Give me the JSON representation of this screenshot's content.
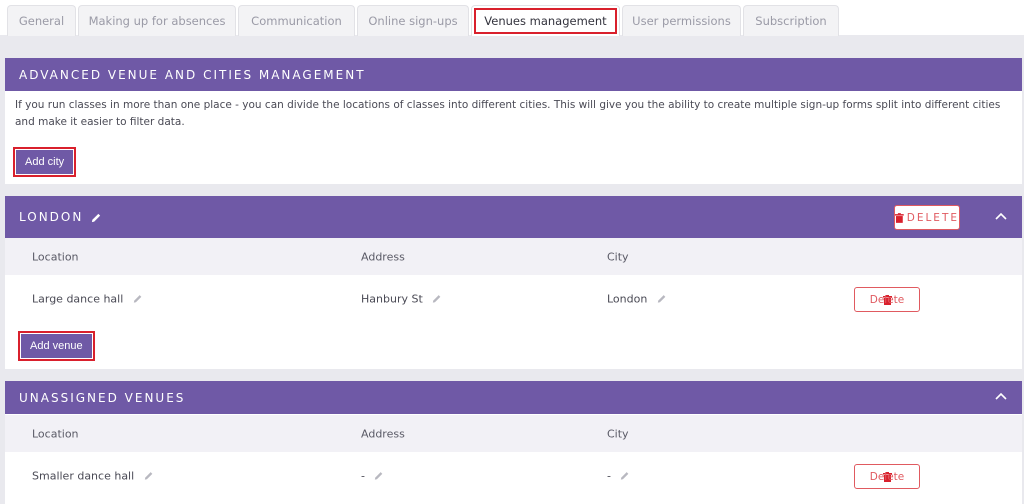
{
  "tabs": [
    {
      "label": "General",
      "active": false
    },
    {
      "label": "Making up for absences",
      "active": false
    },
    {
      "label": "Communication",
      "active": false
    },
    {
      "label": "Online sign-ups",
      "active": false
    },
    {
      "label": "Venues management",
      "active": true
    },
    {
      "label": "User permissions",
      "active": false
    },
    {
      "label": "Subscription",
      "active": false
    }
  ],
  "advanced": {
    "title": "ADVANCED VENUE AND CITIES MANAGEMENT",
    "description": "If you run classes in more than one place - you can divide the locations of classes into different cities. This will give you the ability to create multiple sign-up forms split into different cities and make it easier to filter data.",
    "add_city_label": "Add city"
  },
  "london": {
    "title": "LONDON",
    "delete_label": "Delete",
    "columns": [
      "Location",
      "Address",
      "City"
    ],
    "rows": [
      {
        "location": "Large dance hall",
        "address": "Hanbury St",
        "city": "London",
        "delete_label": "Delete"
      }
    ],
    "add_venue_label": "Add venue"
  },
  "unassigned": {
    "title": "UNASSIGNED VENUES",
    "columns": [
      "Location",
      "Address",
      "City"
    ],
    "rows": [
      {
        "location": "Smaller dance hall",
        "address": "-",
        "city": "-",
        "delete_label": "Delete"
      }
    ]
  },
  "colors": {
    "accent": "#6f59a6",
    "danger": "#e05a60",
    "highlight": "#d9202c"
  }
}
